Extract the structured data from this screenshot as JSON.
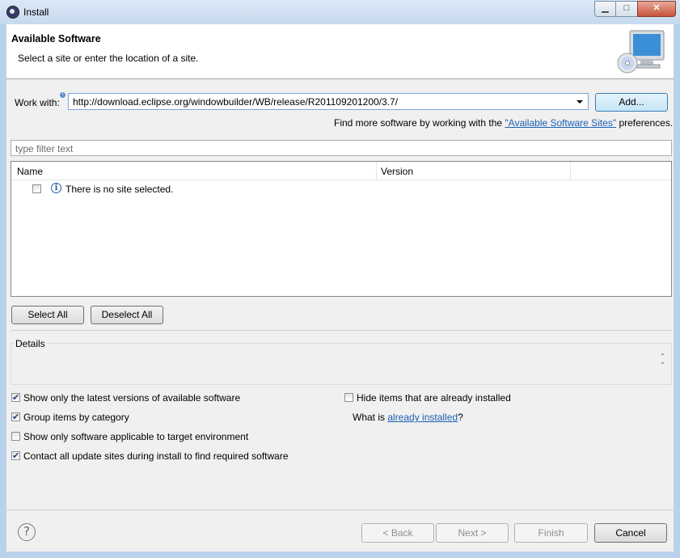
{
  "window": {
    "title": "Install",
    "minimize_glyph": "▁",
    "maximize_glyph": "□",
    "close_glyph": "✕"
  },
  "banner": {
    "title": "Available Software",
    "description": "Select a site or enter the location of a site.",
    "icon": "monitor-cd-icon"
  },
  "work_with": {
    "label": "Work with:",
    "value": "http://download.eclipse.org/windowbuilder/WB/release/R201109201200/3.7/",
    "add_button": "Add...",
    "hint_prefix": "Find more software by working with the ",
    "hint_link": "\"Available Software Sites\"",
    "hint_suffix": " preferences."
  },
  "filter": {
    "placeholder": "type filter text"
  },
  "table": {
    "columns": [
      "Name",
      "Version"
    ],
    "rows": [
      {
        "checked": false,
        "icon": "info-icon",
        "text": "There is no site selected."
      }
    ]
  },
  "selection_buttons": {
    "select_all": "Select All",
    "deselect_all": "Deselect All"
  },
  "details": {
    "label": "Details"
  },
  "options": {
    "latest_versions": {
      "label": "Show only the latest versions of available software",
      "checked": true
    },
    "group_by_category": {
      "label": "Group items by category",
      "checked": true
    },
    "target_env": {
      "label": "Show only software applicable to target environment",
      "checked": false
    },
    "contact_sites": {
      "label": "Contact all update sites during install to find required software",
      "checked": true
    },
    "hide_installed": {
      "label": "Hide items that are already installed",
      "checked": false
    },
    "what_is_prefix": "What is ",
    "what_is_link": "already installed",
    "what_is_suffix": "?"
  },
  "footer": {
    "help_glyph": "?",
    "back": "< Back",
    "next": "Next >",
    "finish": "Finish",
    "cancel": "Cancel"
  },
  "colors": {
    "link": "#1a5fb4",
    "primary_button": "#c4e5f6"
  }
}
